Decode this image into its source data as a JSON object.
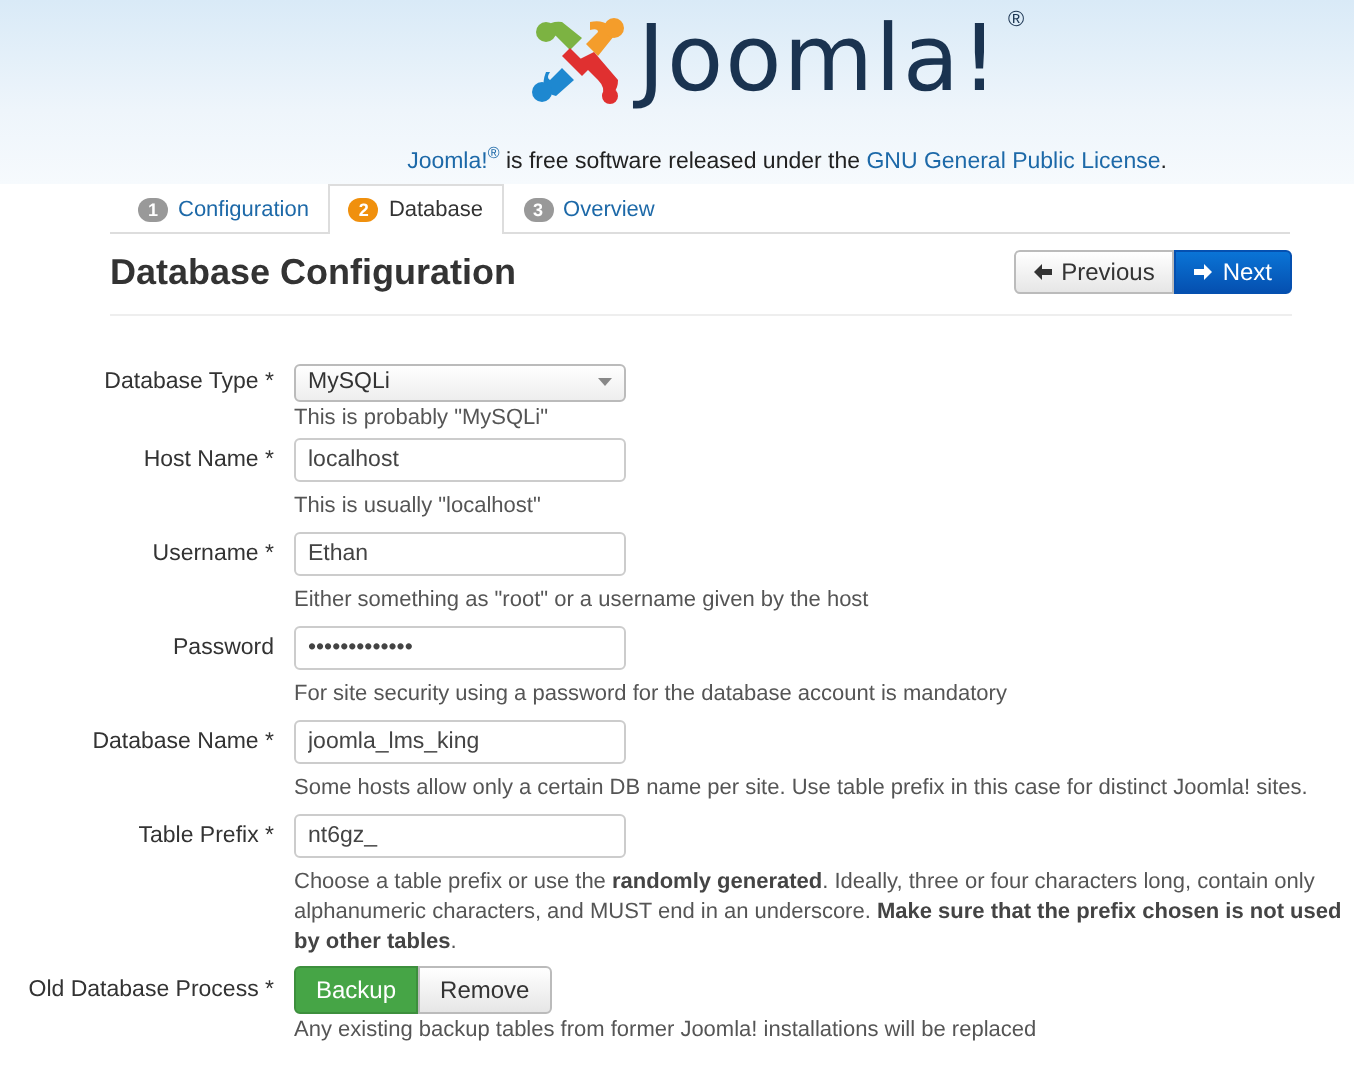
{
  "logo": {
    "text": "Joomla!",
    "mark": "®"
  },
  "license": [
    {
      "kind": "link",
      "text": "Joomla!$^{®}$"
    },
    {
      "kind": "text",
      "text": " is free software released under the "
    },
    {
      "kind": "link",
      "text": "GNU General Public License"
    },
    {
      "kind": "text",
      "text": "."
    }
  ],
  "tabs": [
    {
      "number": "1",
      "label": "Configuration",
      "selected": false
    },
    {
      "number": "2",
      "label": "Database",
      "selected": true
    },
    {
      "number": "3",
      "label": "Overview",
      "selected": false
    }
  ],
  "heading": "Database Configuration",
  "buttons": [
    {
      "kind": "previous",
      "label": "Previous"
    },
    {
      "kind": "next",
      "label": "Next"
    }
  ],
  "fields": [
    {
      "kind": "select",
      "label": "Database Type *",
      "value": "MySQLi",
      "hint": "This is probably \"MySQLi\""
    },
    {
      "kind": "text",
      "label": "Host Name *",
      "value": "localhost",
      "hint": "This is usually \"localhost\""
    },
    {
      "kind": "text",
      "label": "Username *",
      "value": "Ethan",
      "hint": "Either something as \"root\" or a username given by the host"
    },
    {
      "kind": "password",
      "label": "Password",
      "value": "•••••••••••••",
      "hint": "For site security using a password for the database account is mandatory"
    },
    {
      "kind": "text",
      "label": "Database Name *",
      "value": "joomla_lms_king",
      "hint": "Some hosts allow only a certain DB name per site. Use table prefix in this case for distinct Joomla! sites."
    },
    {
      "kind": "text",
      "label": "Table Prefix *",
      "value": "nt6gz_",
      "hint": "Choose a table prefix or use the **randomly generated**. Ideally, three or four characters long, contain only alphanumeric characters, and MUST end in an underscore. **Make sure that the prefix chosen is not used by other tables**."
    },
    {
      "kind": "toggle",
      "label": "Old Database Process *",
      "options": [
        {
          "label": "Backup",
          "selected": true
        },
        {
          "label": "Remove",
          "selected": false
        }
      ],
      "hint": "Any existing backup tables from former Joomla! installations will be replaced"
    }
  ]
}
